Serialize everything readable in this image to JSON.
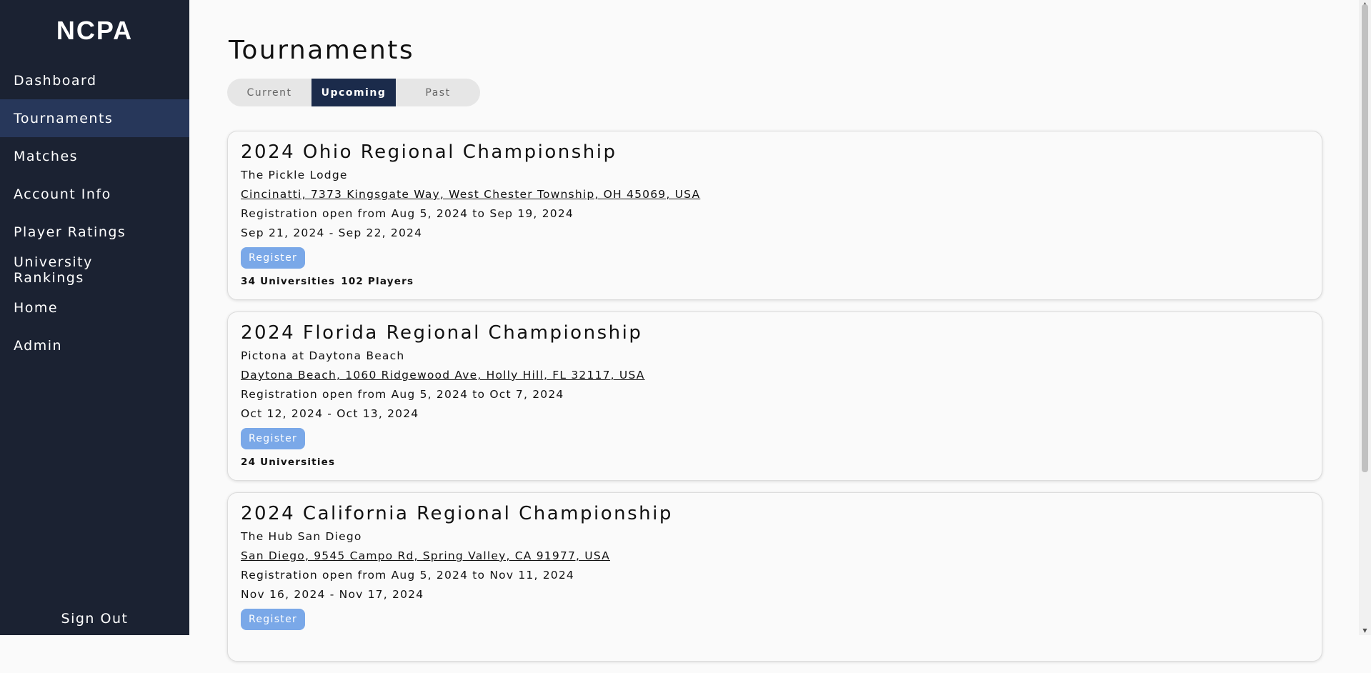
{
  "sidebar": {
    "logo": "NCPA",
    "items": [
      {
        "label": "Dashboard"
      },
      {
        "label": "Tournaments"
      },
      {
        "label": "Matches"
      },
      {
        "label": "Account Info"
      },
      {
        "label": "Player Ratings"
      },
      {
        "label": "University Rankings"
      },
      {
        "label": "Home"
      },
      {
        "label": "Admin"
      }
    ],
    "active_item": "Tournaments",
    "sign_out": "Sign Out"
  },
  "main": {
    "title": "Tournaments",
    "tabs": [
      {
        "label": "Current"
      },
      {
        "label": "Upcoming"
      },
      {
        "label": "Past"
      }
    ],
    "active_tab": "Upcoming",
    "tournaments": [
      {
        "name": "2024 Ohio Regional Championship",
        "venue": "The Pickle Lodge",
        "address": "Cincinatti, 7373 Kingsgate Way, West Chester Township, OH 45069, USA",
        "registration": "Registration open from Aug 5, 2024 to Sep 19, 2024",
        "dates": "Sep 21, 2024 - Sep 22, 2024",
        "register_label": "Register",
        "universities": "34 Universities",
        "players": "102 Players"
      },
      {
        "name": "2024 Florida Regional Championship",
        "venue": "Pictona at Daytona Beach",
        "address": "Daytona Beach, 1060 Ridgewood Ave, Holly Hill, FL 32117, USA",
        "registration": "Registration open from Aug 5, 2024 to Oct 7, 2024",
        "dates": "Oct 12, 2024 - Oct 13, 2024",
        "register_label": "Register",
        "universities": "24 Universities",
        "players": ""
      },
      {
        "name": "2024 California Regional Championship",
        "venue": "The Hub San Diego",
        "address": "San Diego, 9545 Campo Rd, Spring Valley, CA 91977, USA",
        "registration": "Registration open from Aug 5, 2024 to Nov 11, 2024",
        "dates": "Nov 16, 2024 - Nov 17, 2024",
        "register_label": "Register",
        "universities": "",
        "players": ""
      }
    ]
  },
  "colors": {
    "sidebar_bg": "#1b2232",
    "sidebar_active": "#27375a",
    "tab_active": "#1b2b4b",
    "register_button": "#7aa8e8"
  }
}
